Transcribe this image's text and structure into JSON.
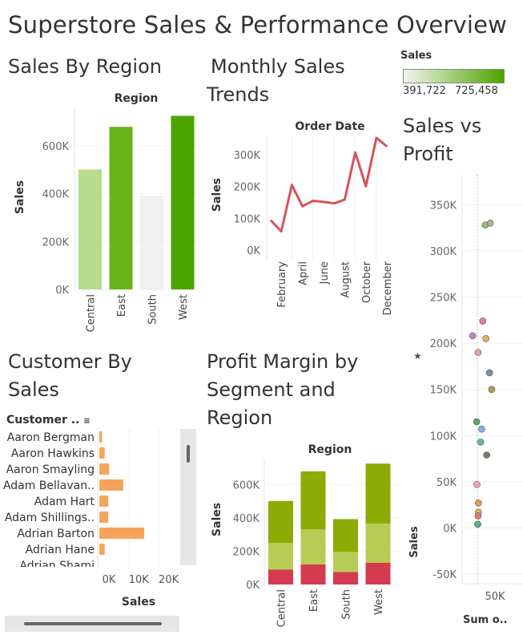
{
  "dashboard": {
    "title": "Superstore Sales & Performance Overview"
  },
  "legend": {
    "title": "Sales",
    "min_label": "391,722",
    "max_label": "725,458",
    "color_low": "#f2f5ec",
    "color_high": "#4ca400"
  },
  "sales_by_region": {
    "title": "Sales By Region",
    "header": "Region",
    "ylabel": "Sales",
    "yticks": [
      "0K",
      "200K",
      "400K",
      "600K"
    ]
  },
  "monthly_trends": {
    "title_line1": "Monthly Sales",
    "title_line2": "Trends",
    "header": "Order Date",
    "ylabel": "Sales",
    "yticks": [
      "0K",
      "100K",
      "200K",
      "300K"
    ],
    "xticks": [
      "February",
      "April",
      "June",
      "August",
      "October",
      "December"
    ]
  },
  "sales_vs_profit": {
    "title_line1": "Sales vs",
    "title_line2": "Profit",
    "ylabel": "Sales",
    "xlabel": "Sum o..",
    "yticks": [
      "-50K",
      "0K",
      "50K",
      "100K",
      "150K",
      "200K",
      "250K",
      "300K",
      "350K"
    ],
    "xtick": "50K"
  },
  "customer_by_sales": {
    "title_line1": "Customer By",
    "title_line2": "Sales",
    "header": "Customer ..",
    "xlabel": "Sales",
    "xticks": [
      "0K",
      "10K",
      "20K"
    ]
  },
  "profit_margin": {
    "title_line1": "Profit Margin by",
    "title_line2": "Segment and",
    "title_line3": "Region",
    "header": "Region",
    "ylabel": "Sales",
    "yticks": [
      "0K",
      "200K",
      "400K",
      "600K"
    ]
  },
  "chart_data": [
    {
      "type": "bar",
      "id": "sales_by_region",
      "categories": [
        "Central",
        "East",
        "South",
        "West"
      ],
      "values": [
        501000,
        679000,
        392000,
        725000
      ],
      "colors": [
        "#b7dc8e",
        "#69b41c",
        "#f0f0f0",
        "#4ca400"
      ],
      "ylim": [
        0,
        760000
      ]
    },
    {
      "type": "line",
      "id": "monthly_trends",
      "x": [
        "January",
        "February",
        "March",
        "April",
        "May",
        "June",
        "July",
        "August",
        "September",
        "October",
        "November",
        "December"
      ],
      "values": [
        94000,
        59000,
        205000,
        138000,
        155000,
        152000,
        147000,
        159000,
        307000,
        201000,
        353000,
        326000
      ],
      "color": "#d9525b",
      "ylim": [
        0,
        360000
      ]
    },
    {
      "type": "scatter",
      "id": "sales_vs_profit",
      "points": [
        {
          "x": 22000,
          "y": 328000,
          "color": "#8cc66a"
        },
        {
          "x": 36000,
          "y": 330000,
          "color": "#b9a8a2"
        },
        {
          "x": 15000,
          "y": 224000,
          "color": "#d87fa8"
        },
        {
          "x": -13000,
          "y": 208000,
          "color": "#c783c6"
        },
        {
          "x": 24000,
          "y": 205000,
          "color": "#e0b260"
        },
        {
          "x": 2000,
          "y": 190000,
          "color": "#f19bab"
        },
        {
          "x": 34000,
          "y": 168000,
          "color": "#6f8fb3"
        },
        {
          "x": 40000,
          "y": 150000,
          "color": "#b69b4e"
        },
        {
          "x": -2000,
          "y": 115000,
          "color": "#64a85c"
        },
        {
          "x": 12000,
          "y": 107000,
          "color": "#89aee0"
        },
        {
          "x": 9000,
          "y": 93000,
          "color": "#6bb5a3"
        },
        {
          "x": 26000,
          "y": 79000,
          "color": "#7f7767"
        },
        {
          "x": -1000,
          "y": 47000,
          "color": "#f2a3b6"
        },
        {
          "x": 3000,
          "y": 27000,
          "color": "#e49a55"
        },
        {
          "x": 3000,
          "y": 17000,
          "color": "#e9b35d"
        },
        {
          "x": 2000,
          "y": 13000,
          "color": "#d87f6d"
        },
        {
          "x": 1000,
          "y": 4000,
          "color": "#61a88e"
        }
      ],
      "xlim": [
        -20000,
        60000
      ],
      "ylim": [
        -60000,
        380000
      ]
    },
    {
      "type": "bar",
      "id": "customer_by_sales",
      "orientation": "horizontal",
      "categories": [
        "Aaron Bergman",
        "Aaron Hawkins",
        "Aaron Smayling",
        "Adam Bellavan..",
        "Adam Hart",
        "Adam Shillings..",
        "Adrian Barton",
        "Adrian Hane",
        "Adrian Shami"
      ],
      "values": [
        900,
        1800,
        3300,
        8000,
        3000,
        3000,
        15000,
        1800,
        0
      ],
      "color": "#f4a55b",
      "xlim": [
        0,
        28000
      ]
    },
    {
      "type": "bar",
      "id": "profit_margin",
      "stacked": true,
      "categories": [
        "Central",
        "East",
        "South",
        "West"
      ],
      "series": [
        {
          "values": [
            90000,
            120000,
            75000,
            130000
          ],
          "color": "#d63a4f"
        },
        {
          "values": [
            160000,
            210000,
            120000,
            235000
          ],
          "color": "#b8cc55"
        },
        {
          "values": [
            251000,
            349000,
            197000,
            360000
          ],
          "color": "#8cab05"
        }
      ],
      "ylim": [
        0,
        760000
      ]
    }
  ]
}
